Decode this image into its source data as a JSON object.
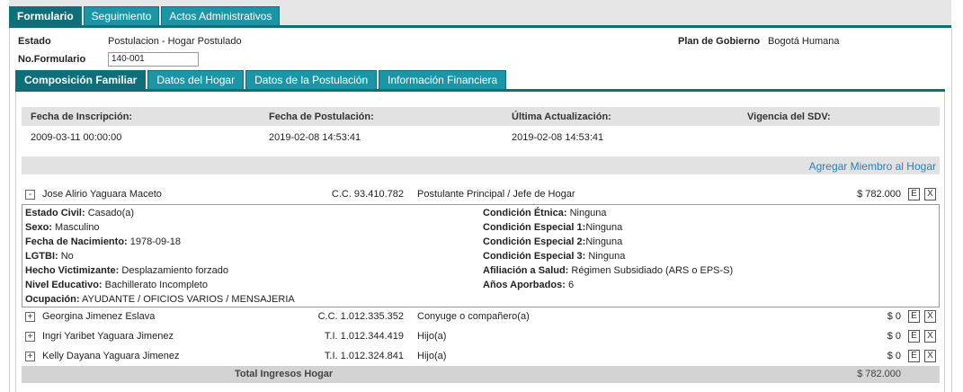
{
  "tabs": [
    "Formulario",
    "Seguimiento",
    "Actos Administrativos"
  ],
  "header": {
    "estado_label": "Estado",
    "estado_value": "Postulacion - Hogar Postulado",
    "formulario_label": "No.Formulario",
    "formulario_value": "140-001",
    "plan_label": "Plan de Gobierno",
    "plan_value": "Bogotá Humana"
  },
  "subtabs": [
    "Composición Familiar",
    "Datos del Hogar",
    "Datos de la Postulación",
    "Información Financiera"
  ],
  "dates": {
    "inscripcion_label": "Fecha de Inscripción:",
    "postulacion_label": "Fecha de Postulación:",
    "actualizacion_label": "Última Actualización:",
    "vigencia_label": "Vigencia del SDV:",
    "inscripcion_value": "2009-03-11 00:00:00",
    "postulacion_value": "2019-02-08 14:53:41",
    "actualizacion_value": "2019-02-08 14:53:41",
    "vigencia_value": ""
  },
  "add_member": "Agregar Miembro al Hogar",
  "members": [
    {
      "toggle": "-",
      "name": "Jose Alirio Yaguara Maceto",
      "doc": "C.C. 93.410.782",
      "relation": "Postulante Principal / Jefe de Hogar",
      "amount": "$ 782.000",
      "edit": "E",
      "delete": "X"
    },
    {
      "toggle": "+",
      "name": "Georgina Jimenez Eslava",
      "doc": "C.C. 1.012.335.352",
      "relation": "Conyuge o compañero(a)",
      "amount": "$ 0",
      "edit": "E",
      "delete": "X"
    },
    {
      "toggle": "+",
      "name": "Ingri Yaribet Yaguara Jimenez",
      "doc": "T.I. 1.012.344.419",
      "relation": "Hijo(a)",
      "amount": "$ 0",
      "edit": "E",
      "delete": "X"
    },
    {
      "toggle": "+",
      "name": "Kelly Dayana Yaguara Jimenez",
      "doc": "T.I. 1.012.324.841",
      "relation": "Hijo(a)",
      "amount": "$ 0",
      "edit": "E",
      "delete": "X"
    }
  ],
  "details": {
    "left": [
      {
        "label": "Estado Civil:",
        "value": "Casado(a)"
      },
      {
        "label": "Sexo:",
        "value": "Masculino"
      },
      {
        "label": "Fecha de Nacimiento:",
        "value": "1978-09-18"
      },
      {
        "label": "LGTBI:",
        "value": "No"
      },
      {
        "label": "Hecho Victimizante:",
        "value": "Desplazamiento forzado"
      },
      {
        "label": "Nivel Educativo:",
        "value": "Bachillerato Incompleto"
      },
      {
        "label": "Ocupación:",
        "value": "AYUDANTE / OFICIOS VARIOS / MENSAJERIA"
      }
    ],
    "right": [
      {
        "label": "Condición Étnica:",
        "value": "Ninguna"
      },
      {
        "label": "Condición Especial 1:",
        "value": "Ninguna"
      },
      {
        "label": "Condición Especial 2:",
        "value": "Ninguna"
      },
      {
        "label": "Condición Especial 3:",
        "value": "Ninguna"
      },
      {
        "label": "Afiliación a Salud:",
        "value": "Régimen Subsidiado (ARS o EPS-S)"
      },
      {
        "label": "Años Aporbados:",
        "value": "6"
      }
    ]
  },
  "total": {
    "label": "Total Ingresos Hogar",
    "value": "$ 782.000"
  },
  "colors": {
    "tab": "#1b96a6",
    "tab_active": "#0e6e7a",
    "link": "#2a7fb5",
    "bar": "#e2e2e2",
    "total_bar": "#d3d3d3"
  }
}
